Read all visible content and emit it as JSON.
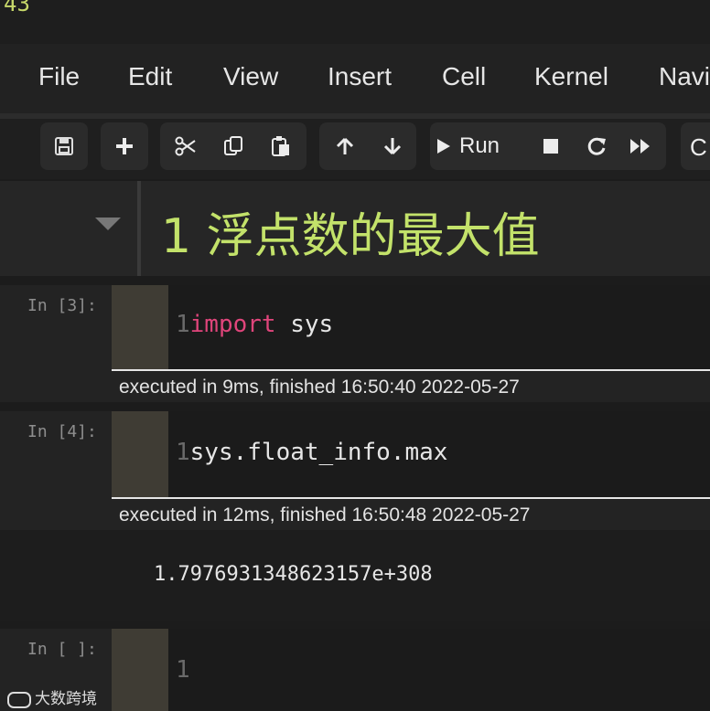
{
  "top_number": "43",
  "menu": [
    "File",
    "Edit",
    "View",
    "Insert",
    "Cell",
    "Kernel",
    "Navi"
  ],
  "toolbar": {
    "run_label": "Run",
    "partial_label": "C"
  },
  "heading": "1  浮点数的最大值",
  "cells": [
    {
      "prompt": "In [3]:",
      "line_no": "1",
      "keyword": "import",
      "code_rest": " sys",
      "exec": "executed in 9ms, finished 16:50:40 2022-05-27"
    },
    {
      "prompt": "In [4]:",
      "line_no": "1",
      "code": "sys.float_info.max",
      "exec": "executed in 12ms, finished 16:50:48 2022-05-27",
      "output": "1.7976931348623157e+308"
    },
    {
      "prompt": "In [ ]:",
      "line_no": "1"
    }
  ],
  "watermark": "大数跨境",
  "colors": {
    "heading": "#c3e26a",
    "keyword": "#e0457b",
    "background": "#1c1c1c"
  }
}
